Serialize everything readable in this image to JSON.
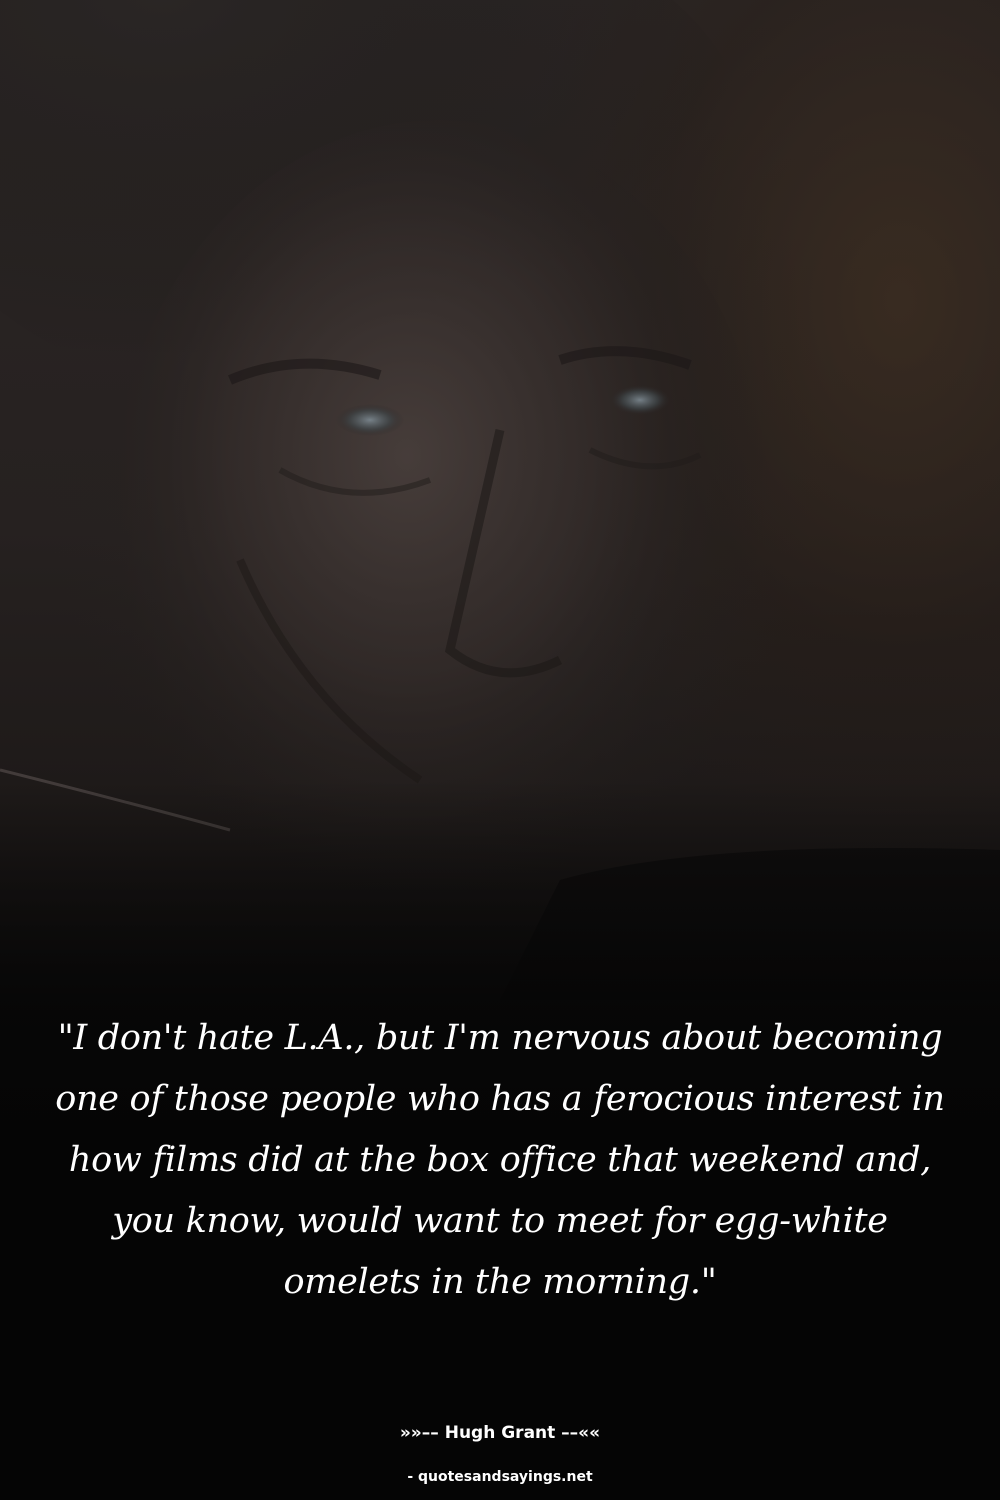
{
  "quote": {
    "text": "\"I don't hate L.A., but I'm nervous about becoming one of those people who has a ferocious interest in how films did at the box office that weekend and, you know, would want to meet for egg-white omelets in the morning.\""
  },
  "attribution": {
    "author_line": "»»–– Hugh Grant ––««"
  },
  "watermark": {
    "site": "- quotesandsayings.net"
  },
  "photo": {
    "subject": "dark close-up portrait of a man's face",
    "colors": {
      "shadow": "#050505",
      "skin": "#3a3230",
      "background_warm": "#3b2a1d"
    }
  }
}
